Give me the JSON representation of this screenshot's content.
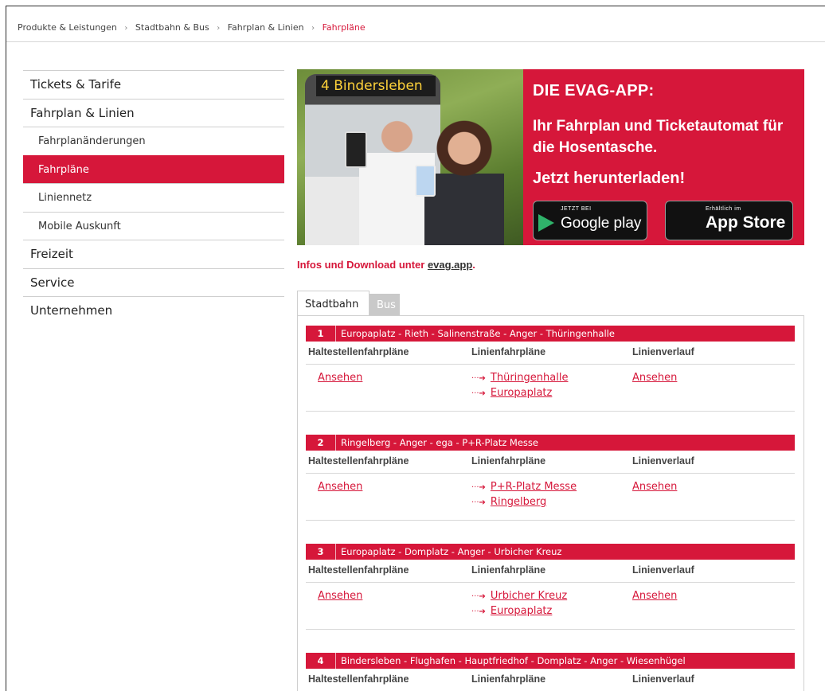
{
  "breadcrumb": {
    "items": [
      "Produkte & Leistungen",
      "Stadtbahn & Bus",
      "Fahrplan & Linien"
    ],
    "current": "Fahrpläne"
  },
  "sidebar": {
    "items": [
      {
        "label": "Tickets & Tarife",
        "level": 1
      },
      {
        "label": "Fahrplan & Linien",
        "level": 1
      },
      {
        "label": "Fahrplanänderungen",
        "level": 2
      },
      {
        "label": "Fahrpläne",
        "level": 2,
        "active": true
      },
      {
        "label": "Liniennetz",
        "level": 2
      },
      {
        "label": "Mobile Auskunft",
        "level": 2
      },
      {
        "label": "Freizeit",
        "level": 1
      },
      {
        "label": "Service",
        "level": 1
      },
      {
        "label": "Unternehmen",
        "level": 1
      }
    ]
  },
  "banner": {
    "photo_sign": "4 Bindersleben",
    "title": "DIE EVAG-APP:",
    "subtitle": "Ihr Fahrplan und Ticketautomat für die Hosentasche.",
    "cta": "Jetzt herunterladen!",
    "google_small": "JETZT BEI",
    "google_big": "Google play",
    "apple_small": "Erhältlich im",
    "apple_big": "App Store"
  },
  "info": {
    "text": "Infos und Download unter ",
    "link": "evag.app",
    "suffix": "."
  },
  "tabs": [
    "Stadtbahn",
    "Bus"
  ],
  "columns": {
    "stops": "Haltestellenfahrpläne",
    "lines": "Linienfahrpläne",
    "route": "Linienverlauf"
  },
  "view_label": "Ansehen",
  "lines": [
    {
      "number": "1",
      "route": "Europaplatz - Rieth - Salinenstraße - Anger - Thüringenhalle",
      "directions": [
        "Thüringenhalle",
        "Europaplatz"
      ]
    },
    {
      "number": "2",
      "route": "Ringelberg - Anger - ega - P+R-Platz Messe",
      "directions": [
        "P+R-Platz Messe",
        "Ringelberg"
      ]
    },
    {
      "number": "3",
      "route": "Europaplatz - Domplatz - Anger - Urbicher Kreuz",
      "directions": [
        "Urbicher Kreuz",
        "Europaplatz"
      ]
    },
    {
      "number": "4",
      "route": "Bindersleben - Flughafen - Hauptfriedhof - Domplatz - Anger - Wiesenhügel",
      "directions": []
    }
  ],
  "colors": {
    "accent": "#d6173a",
    "tab_inactive": "#c9c9c9"
  },
  "icons": {
    "breadcrumb_separator": "chevron-right-icon",
    "direction_arrow": "dotted-arrow-right-icon",
    "google_play": "google-play-icon",
    "apple": "apple-icon"
  }
}
